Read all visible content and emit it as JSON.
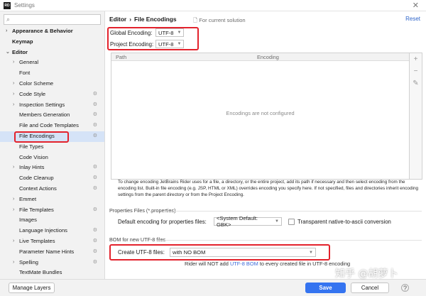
{
  "window": {
    "title": "Settings",
    "app_icon_text": "RD"
  },
  "sidebar": {
    "search_placeholder": "",
    "items": [
      {
        "label": "Appearance & Behavior",
        "arrow": "›",
        "bold": true
      },
      {
        "label": "Keymap",
        "bold": true
      },
      {
        "label": "Editor",
        "arrow": "⌄",
        "bold": true
      },
      {
        "label": "General",
        "arrow": "›"
      },
      {
        "label": "Font"
      },
      {
        "label": "Color Scheme",
        "arrow": "›"
      },
      {
        "label": "Code Style",
        "arrow": "›",
        "gear": true
      },
      {
        "label": "Inspection Settings",
        "arrow": "›",
        "gear": true
      },
      {
        "label": "Members Generation",
        "gear": true
      },
      {
        "label": "File and Code Templates",
        "gear": true
      },
      {
        "label": "File Encodings",
        "gear": true,
        "selected": true
      },
      {
        "label": "File Types"
      },
      {
        "label": "Code Vision"
      },
      {
        "label": "Inlay Hints",
        "arrow": "›",
        "gear": true
      },
      {
        "label": "Code Cleanup",
        "gear": true
      },
      {
        "label": "Context Actions",
        "gear": true
      },
      {
        "label": "Emmet",
        "arrow": "›"
      },
      {
        "label": "File Templates",
        "arrow": "›",
        "gear": true
      },
      {
        "label": "Images"
      },
      {
        "label": "Language Injections",
        "gear": true
      },
      {
        "label": "Live Templates",
        "arrow": "›",
        "gear": true
      },
      {
        "label": "Parameter Name Hints",
        "gear": true
      },
      {
        "label": "Spelling",
        "arrow": "›",
        "gear": true
      },
      {
        "label": "TextMate Bundles"
      }
    ]
  },
  "header": {
    "crumb1": "Editor",
    "separator": "›",
    "crumb2": "File Encodings",
    "for_current": "For current solution",
    "reset": "Reset"
  },
  "encodings": {
    "global_label": "Global Encoding:",
    "global_value": "UTF-8",
    "project_label": "Project Encoding:",
    "project_value": "UTF-8"
  },
  "table": {
    "col_path": "Path",
    "col_encoding": "Encoding",
    "empty_text": "Encodings are not configured"
  },
  "help_text": "To change encoding JetBrains Rider uses for a file, a directory, or the entire project, add its path if necessary and then select encoding from the encoding list. Built-in file encoding (e.g. JSP, HTML or XML) overrides encoding you specify here. If not specified, files and directories inherit encoding settings from the parent directory or from the Project Encoding.",
  "properties": {
    "section": "Properties Files (*.properties)",
    "default_label": "Default encoding for properties files:",
    "default_value": "<System Default: GBK>",
    "transparent_label": "Transparent native-to-ascii conversion"
  },
  "bom": {
    "section": "BOM for new UTF-8 files",
    "create_label": "Create UTF-8 files:",
    "create_value": "with NO BOM",
    "note_prefix": "Rider will NOT add ",
    "note_link": "UTF-8 BOM",
    "note_suffix": " to every created file in UTF-8 encoding"
  },
  "footer": {
    "manage_layers": "Manage Layers",
    "save": "Save",
    "cancel": "Cancel"
  },
  "watermark": "知乎 @胡萝卜",
  "colors": {
    "selected_bg": "#d5e3f7",
    "accent": "#3574f0",
    "link": "#3c6bd9",
    "highlight": "#e3222c"
  }
}
